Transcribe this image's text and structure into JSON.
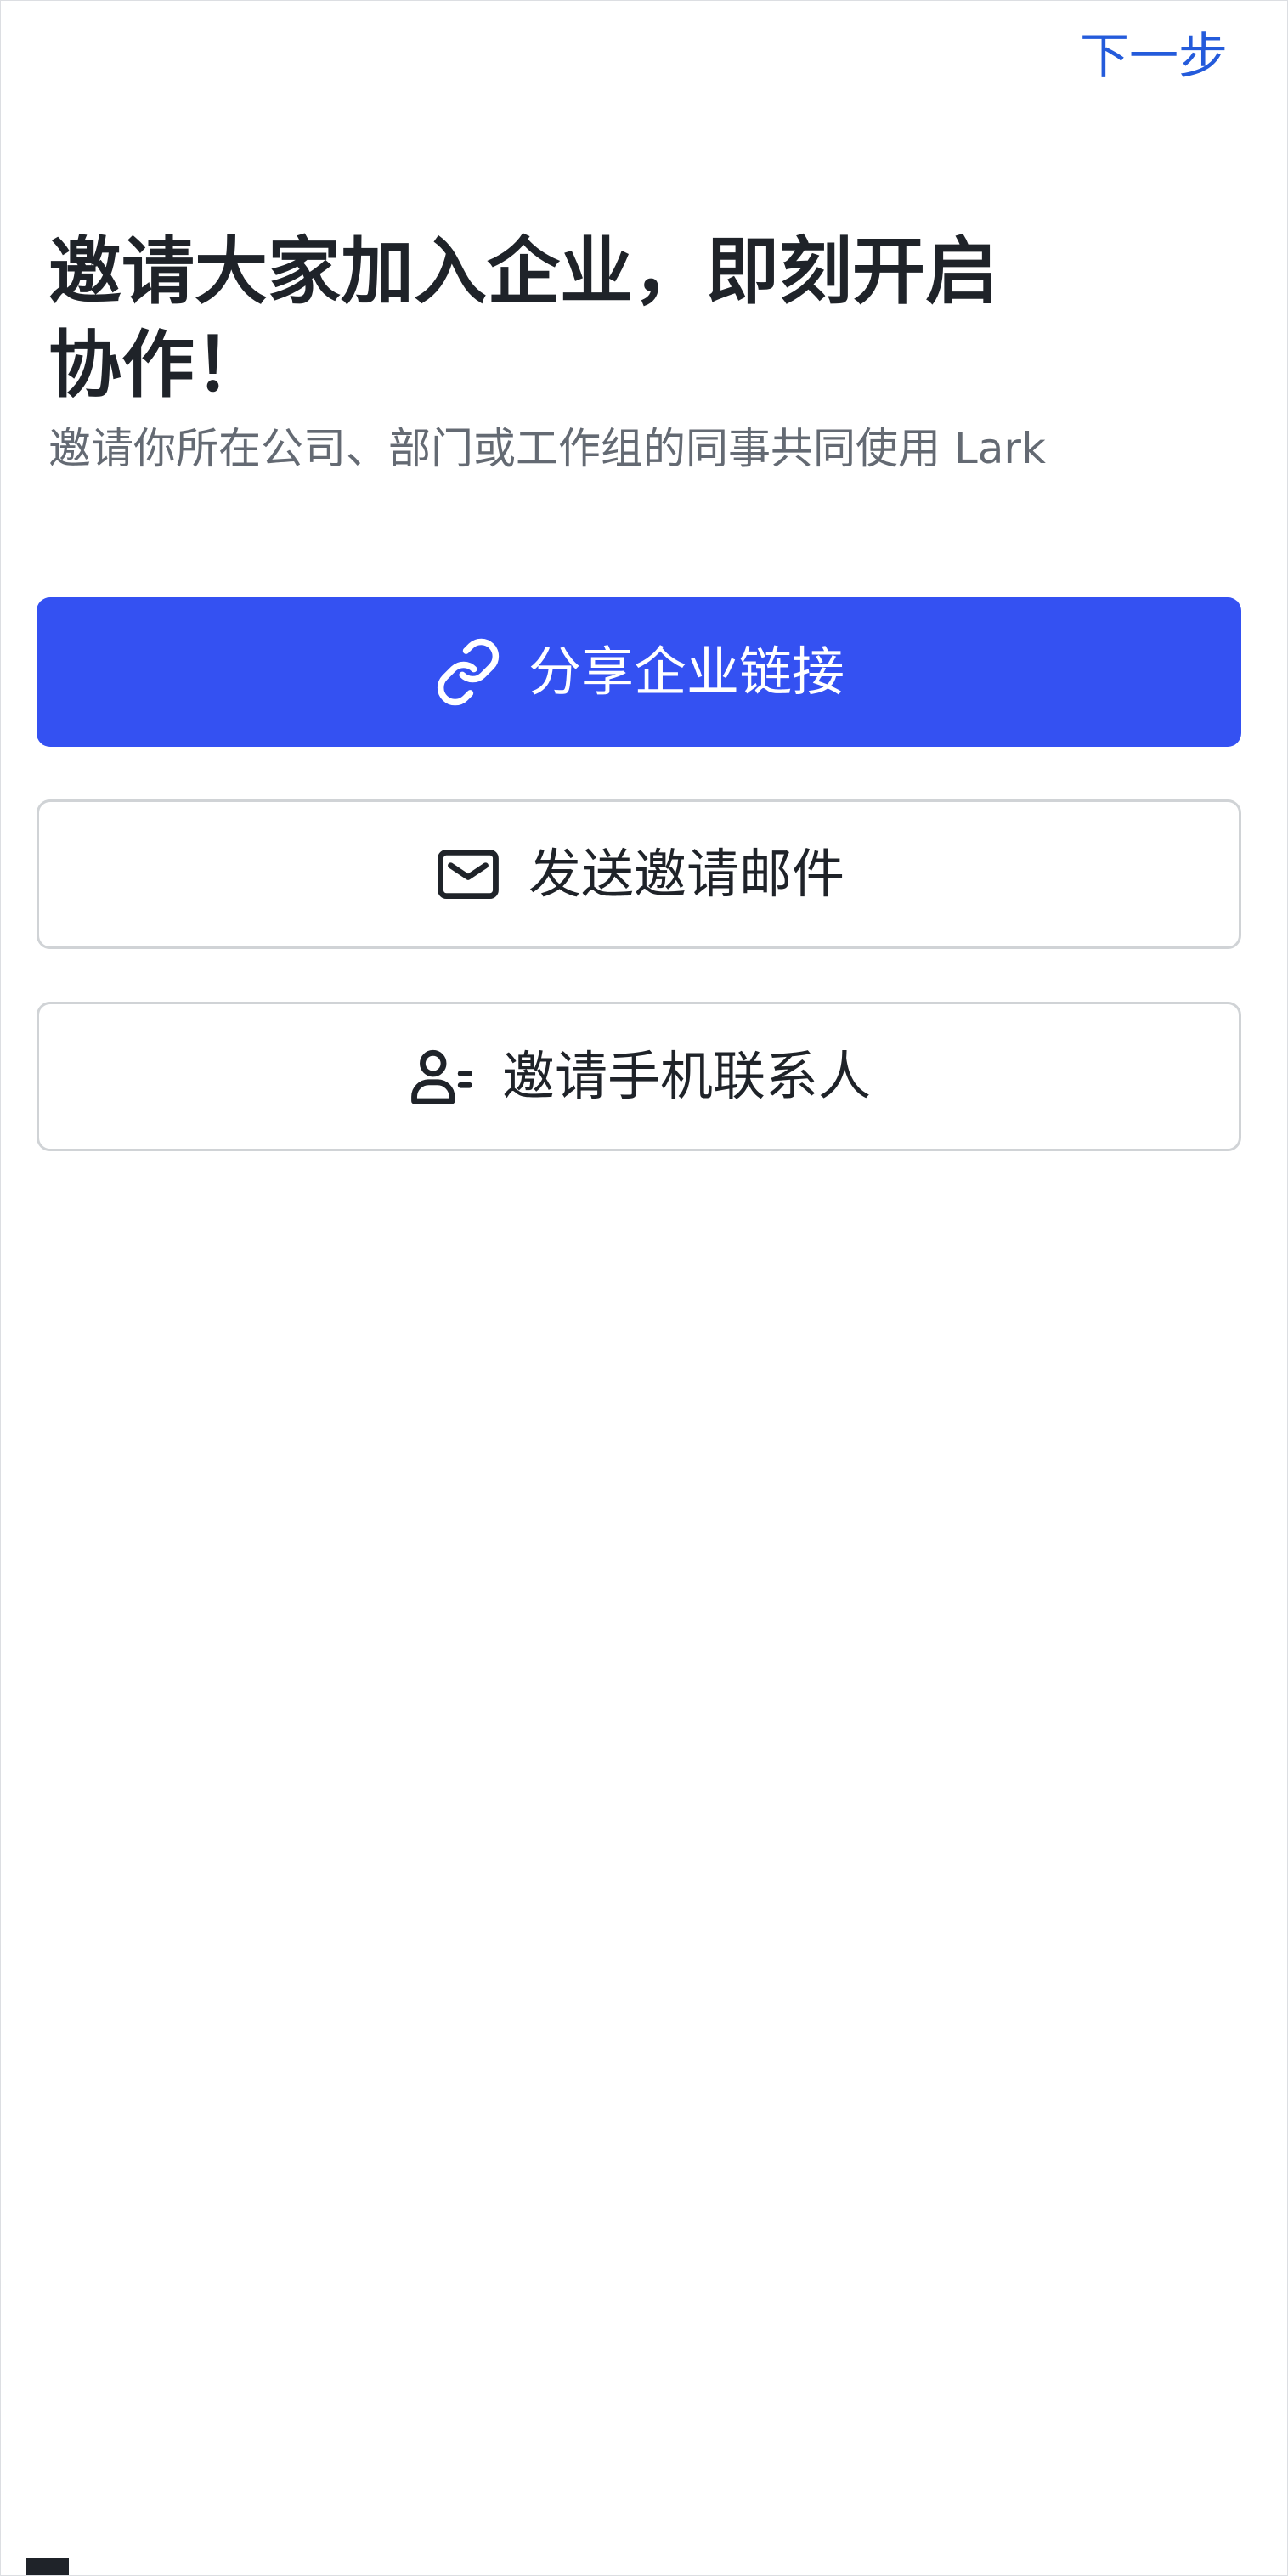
{
  "header": {
    "next_label": "下一步"
  },
  "hero": {
    "title_line1": "邀请大家加入企业，即刻开启",
    "title_line2": "协作！",
    "subtitle": "邀请你所在公司、部门或工作组的同事共同使用 Lark"
  },
  "actions": [
    {
      "label": "分享企业链接",
      "icon": "link-icon"
    },
    {
      "label": "发送邀请邮件",
      "icon": "mail-icon"
    },
    {
      "label": "邀请手机联系人",
      "icon": "contacts-icon"
    }
  ],
  "colors": {
    "accent": "#3451f2",
    "link": "#245bdb",
    "title": "#1f2329",
    "subtitle": "#646a73",
    "border": "#d0d3d6"
  }
}
